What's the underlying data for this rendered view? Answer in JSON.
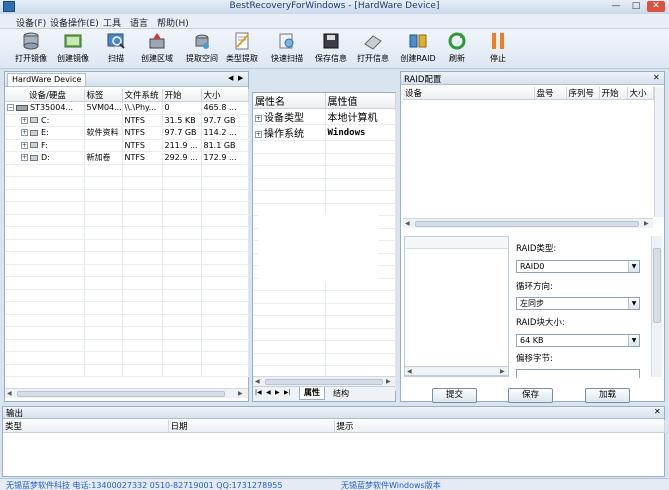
{
  "window": {
    "title": "BestRecoveryForWindows - [HardWare Device]",
    "min": "—",
    "max": "□",
    "close": "✕"
  },
  "menu": [
    "设备(F)",
    "设备操作(E)",
    "工具",
    "语言",
    "帮助(H)"
  ],
  "toolbar": [
    {
      "label": "打开镜像",
      "icon": "disk-open-icon"
    },
    {
      "label": "创建镜像",
      "icon": "create-image-icon"
    },
    {
      "label": "扫描",
      "icon": "scan-icon"
    },
    {
      "label": "创建区域",
      "icon": "create-region-icon"
    },
    {
      "label": "提取空间",
      "icon": "extract-space-icon"
    },
    {
      "label": "类型提取",
      "icon": "type-extract-icon"
    },
    {
      "label": "快速扫描",
      "icon": "quick-scan-icon"
    },
    {
      "label": "保存信息",
      "icon": "save-info-icon"
    },
    {
      "label": "打开信息",
      "icon": "open-info-icon"
    },
    {
      "label": "创建RAID",
      "icon": "create-raid-icon"
    },
    {
      "label": "刷新",
      "icon": "refresh-icon"
    },
    {
      "label": "停止",
      "icon": "stop-icon"
    }
  ],
  "device_panel": {
    "tab": "HardWare Device",
    "columns": [
      "设备/硬盘",
      "标签",
      "文件系统",
      "开始",
      "大小"
    ],
    "rows": [
      {
        "name": "ST35004...",
        "label": "5VM04...",
        "fs": "\\\\.\\Phy...",
        "start": "0",
        "size": "465.8 ..."
      },
      {
        "name": "C:",
        "label": "",
        "fs": "NTFS",
        "start": "31.5 KB",
        "size": "97.7 GB"
      },
      {
        "name": "E:",
        "label": "软件资料",
        "fs": "NTFS",
        "start": "97.7 GB",
        "size": "114.2 ..."
      },
      {
        "name": "F:",
        "label": "",
        "fs": "NTFS",
        "start": "211.9 ...",
        "size": "81.1 GB"
      },
      {
        "name": "D:",
        "label": "新加卷",
        "fs": "NTFS",
        "start": "292.9 ...",
        "size": "172.9 ..."
      }
    ]
  },
  "property_panel": {
    "columns": [
      "属性名",
      "属性值"
    ],
    "rows": [
      {
        "name": "设备类型",
        "value": "本地计算机"
      },
      {
        "name": "操作系统",
        "value": "Windows"
      }
    ],
    "tabs": [
      "属性",
      "结构"
    ]
  },
  "raid_panel": {
    "title": "RAID配置",
    "columns": [
      "设备",
      "盘号",
      "序列号",
      "开始",
      "大小"
    ],
    "raid_type_label": "RAID类型:",
    "raid_type_value": "RAID0",
    "cycle_label": "循环方向:",
    "cycle_value": "左同步",
    "block_label": "RAID块大小:",
    "block_value": "64 KB",
    "offset_label": "偏移字节:",
    "buttons": {
      "submit": "提交",
      "save": "保存",
      "load": "加载"
    }
  },
  "output_panel": {
    "title": "输出",
    "columns": [
      "类型",
      "日期",
      "提示"
    ]
  },
  "status": {
    "left": "无锡蓝梦软件科技 电话:13400027332 0510-82719001 QQ:1731278955",
    "right": "无锡蓝梦软件Windows版本"
  }
}
